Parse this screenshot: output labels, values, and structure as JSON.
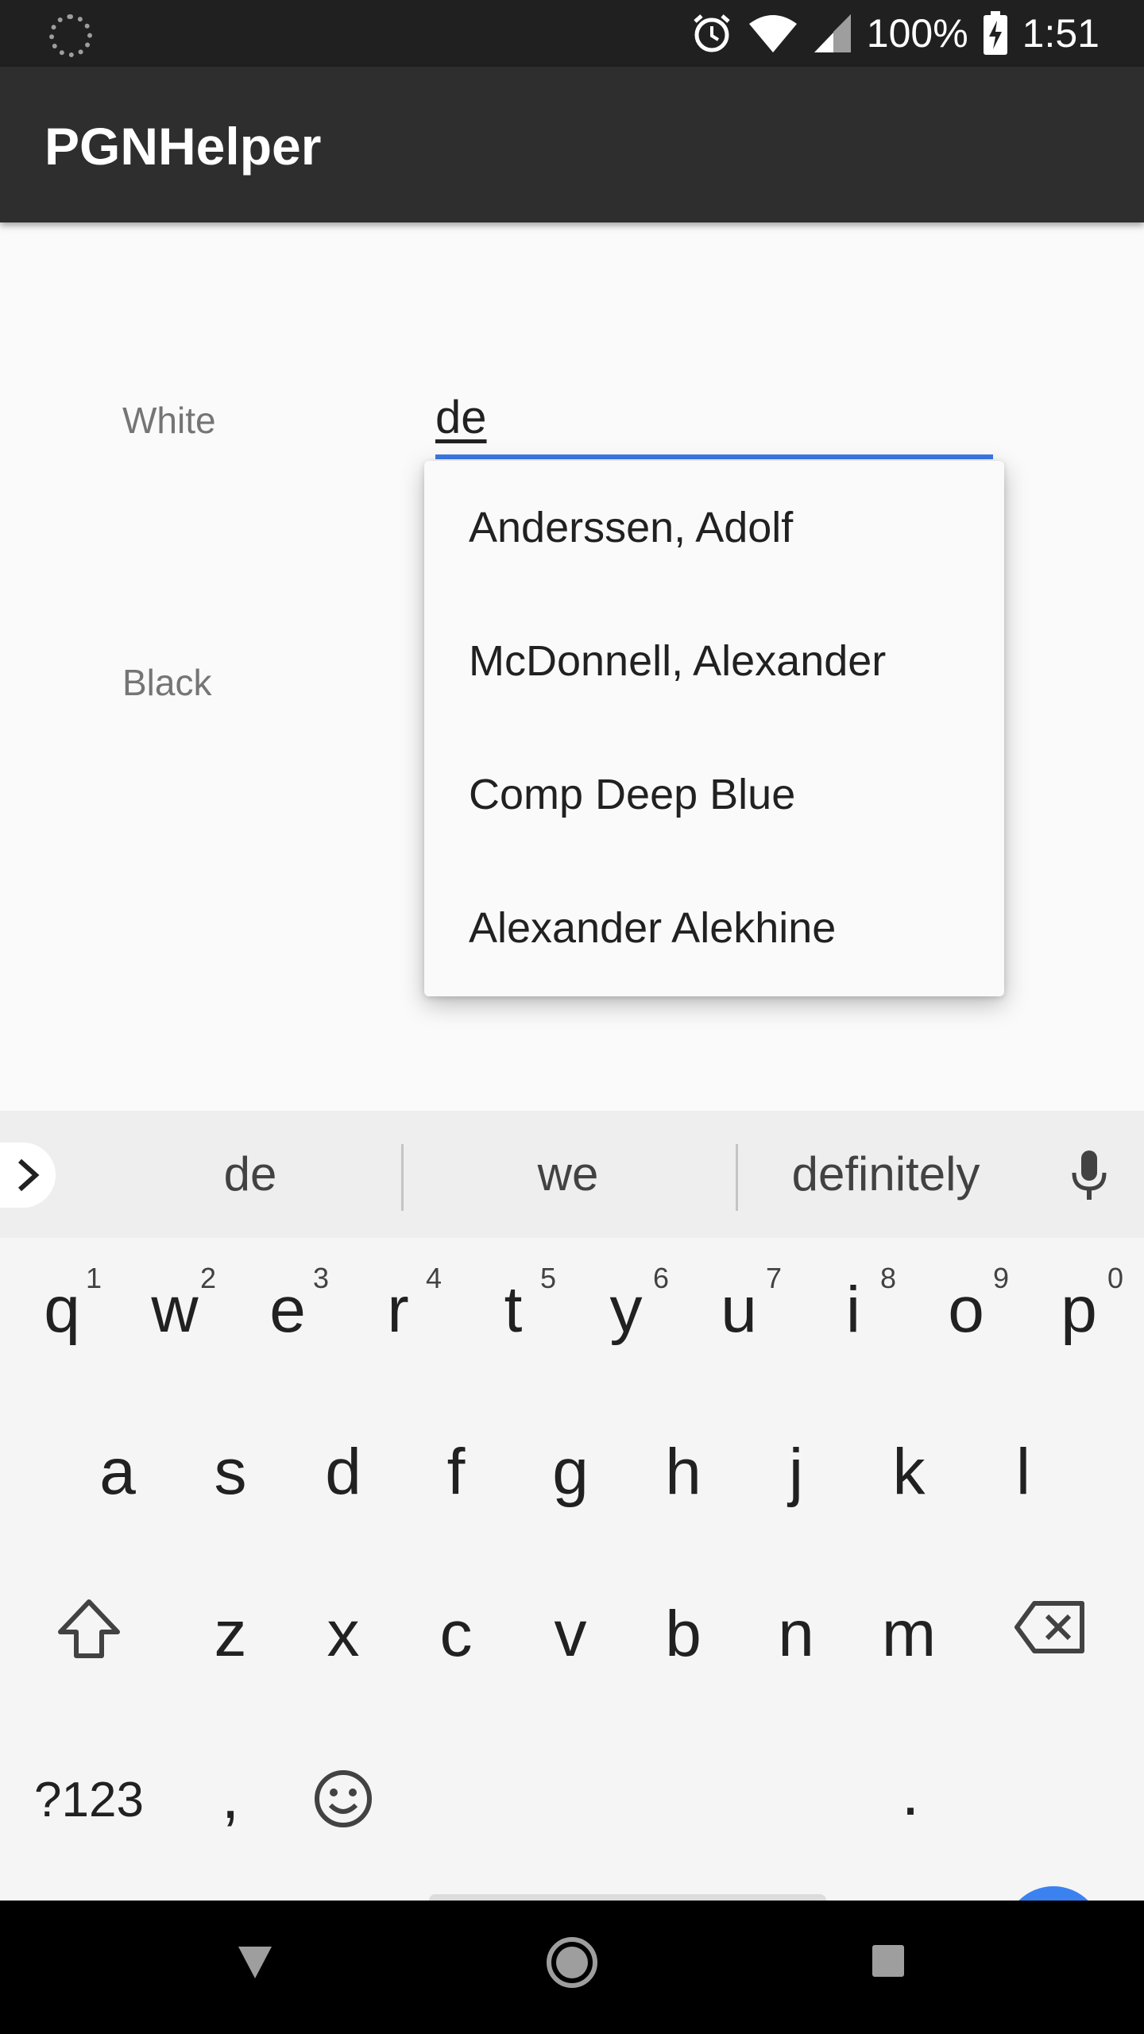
{
  "status_bar": {
    "battery_text": "100%",
    "time": "1:51",
    "icons": [
      "loading-icon",
      "alarm-icon",
      "wifi-icon",
      "signal-icon",
      "battery-charging-icon"
    ]
  },
  "app_bar": {
    "title": "PGNHelper"
  },
  "form": {
    "white_label": "White",
    "black_label": "Black",
    "white_value": "de"
  },
  "autocomplete": {
    "items": [
      "Anderssen, Adolf",
      "McDonnell, Alexander",
      "Comp Deep Blue",
      "Alexander Alekhine"
    ]
  },
  "keyboard": {
    "suggestions": [
      "de",
      "we",
      "definitely"
    ],
    "row1": [
      "q",
      "w",
      "e",
      "r",
      "t",
      "y",
      "u",
      "i",
      "o",
      "p"
    ],
    "row1_hints": [
      "1",
      "2",
      "3",
      "4",
      "5",
      "6",
      "7",
      "8",
      "9",
      "0"
    ],
    "row2": [
      "a",
      "s",
      "d",
      "f",
      "g",
      "h",
      "j",
      "k",
      "l"
    ],
    "row3": [
      "z",
      "x",
      "c",
      "v",
      "b",
      "n",
      "m"
    ],
    "symbols_label": "?123",
    "comma": ",",
    "period": "."
  },
  "colors": {
    "accent": "#3b78e7",
    "enter_key": "#3b82f0",
    "app_bar": "#2e2e2e",
    "status_bar": "#202020"
  }
}
